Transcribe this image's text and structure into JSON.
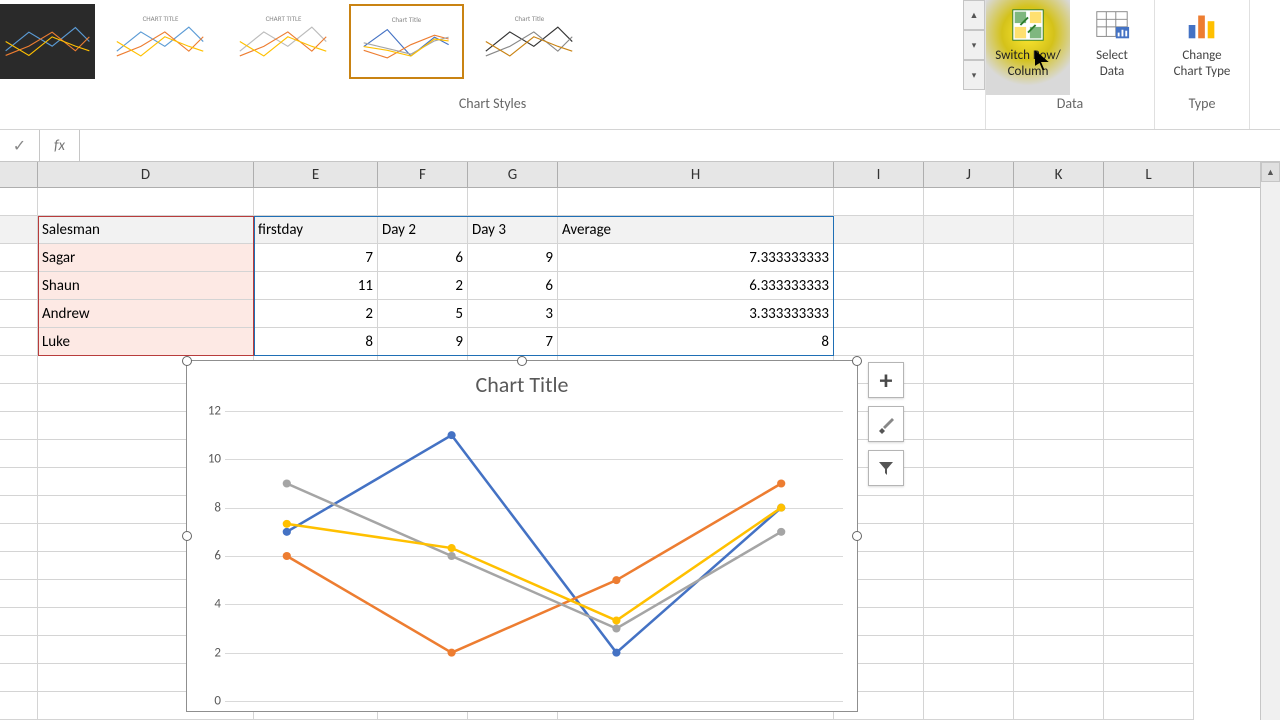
{
  "ribbon": {
    "chart_styles_label": "Chart Styles",
    "switch_label_line1": "Switch Row/",
    "switch_label_line2": "Column",
    "select_data_line1": "Select",
    "select_data_line2": "Data",
    "change_type_line1": "Change",
    "change_type_line2": "Chart Type",
    "data_group_label": "Data",
    "type_group_label": "Type",
    "thumb_title_generic": "CHART TITLE",
    "thumb_title_alt": "Chart Title",
    "scroll_up": "▲",
    "scroll_mid": "▾",
    "scroll_down": "▾"
  },
  "formula_bar": {
    "check": "✓",
    "fx": "fx",
    "value": ""
  },
  "columns": [
    "D",
    "E",
    "F",
    "G",
    "H",
    "I",
    "J",
    "K",
    "L"
  ],
  "table": {
    "headers": [
      "Salesman",
      "firstday",
      "Day 2",
      "Day 3",
      "Average"
    ],
    "rows": [
      {
        "name": "Sagar",
        "d1": 7,
        "d2": 6,
        "d3": 9,
        "avg": "7.333333333"
      },
      {
        "name": "Shaun",
        "d1": 11,
        "d2": 2,
        "d3": 6,
        "avg": "6.333333333"
      },
      {
        "name": "Andrew",
        "d1": 2,
        "d2": 5,
        "d3": 3,
        "avg": "3.333333333"
      },
      {
        "name": "Luke",
        "d1": 8,
        "d2": 9,
        "d3": 7,
        "avg": "8"
      }
    ]
  },
  "chart_side": {
    "plus": "+",
    "brush": "✎",
    "filter": "⏷"
  },
  "chart_data": {
    "type": "line",
    "title": "Chart Title",
    "xlabel": "",
    "ylabel": "",
    "ylim": [
      0,
      12
    ],
    "y_ticks": [
      0,
      2,
      4,
      6,
      8,
      10,
      12
    ],
    "categories": [
      "firstday",
      "Day 2",
      "Day 3",
      "Average"
    ],
    "series": [
      {
        "name": "Sagar",
        "color": "#4472c4",
        "values": [
          7,
          11,
          2,
          8
        ]
      },
      {
        "name": "Shaun",
        "color": "#ed7d31",
        "values": [
          6,
          2,
          5,
          9
        ]
      },
      {
        "name": "Andrew",
        "color": "#a5a5a5",
        "values": [
          9,
          6,
          3,
          7
        ]
      },
      {
        "name": "Luke",
        "color": "#ffc000",
        "values": [
          7.33,
          6.33,
          3.33,
          8
        ]
      }
    ]
  }
}
